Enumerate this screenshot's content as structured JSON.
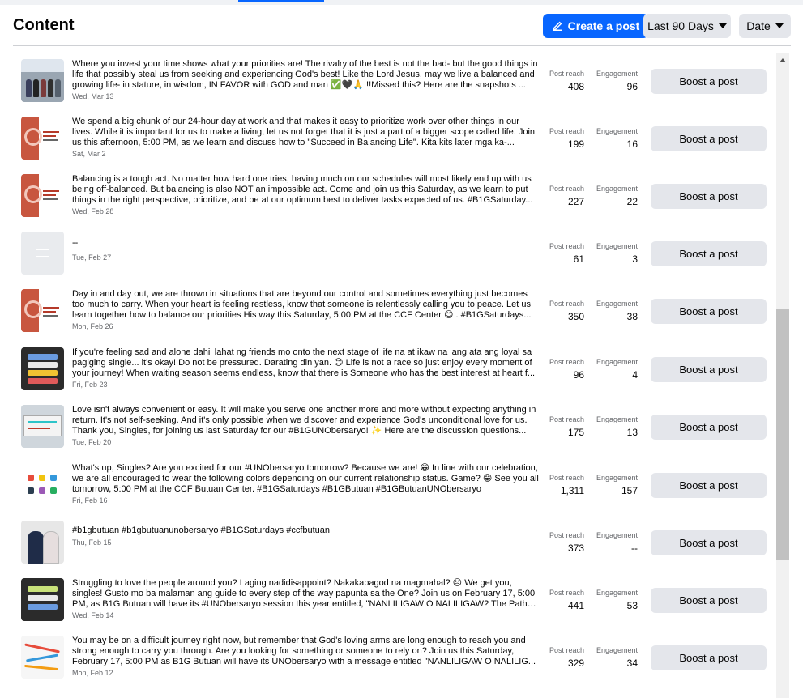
{
  "header": {
    "title": "Content",
    "create_label": "Create a post",
    "range_label": "Last 90 Days",
    "sort_label": "Date"
  },
  "labels": {
    "reach": "Post reach",
    "engagement": "Engagement",
    "boost": "Boost a post"
  },
  "posts": [
    {
      "thumb": "group-photo",
      "caption": "Where you invest your time shows what your priorities are! The rivalry of the best is not the bad- but the good things in life that possibly steal us from seeking and experiencing God's best! Like the Lord Jesus, may we live a balanced and growing life- in stature, in wisdom, IN FAVOR with GOD and man ✅🖤🙏 !!Missed this? Here are the snapshots ...",
      "date": "Wed, Mar 13",
      "reach": "408",
      "engagement": "96"
    },
    {
      "thumb": "event-poster",
      "caption": "We spend a big chunk of our 24-hour day at work and that makes it easy to prioritize work over other things in our lives. While it is important for us to make a living, let us not forget that it is just a part of a bigger scope called life. Join us this afternoon, 5:00 PM, as we learn and discuss how to \"Succeed in Balancing Life\". Kita kits later mga ka-...",
      "date": "Sat, Mar 2",
      "reach": "199",
      "engagement": "16"
    },
    {
      "thumb": "event-poster",
      "caption": "Balancing is a tough act. No matter how hard one tries, having much on our schedules will most likely end up with us being off-balanced. But balancing is also NOT an impossible act. Come and join us this Saturday, as we learn to put things in the right perspective, prioritize, and be at our optimum best to deliver tasks expected of us. #B1GSaturday...",
      "date": "Wed, Feb 28",
      "reach": "227",
      "engagement": "22"
    },
    {
      "thumb": "placeholder",
      "caption": "--",
      "date": "Tue, Feb 27",
      "reach": "61",
      "engagement": "3"
    },
    {
      "thumb": "event-poster",
      "caption": "Day in and day out, we are thrown in situations that are beyond our control and sometimes everything just becomes too much to carry. When your heart is feeling restless, know that someone is relentlessly calling you to peace. Let us learn together how to balance our priorities His way this Saturday, 5:00 PM at the CCF Center 😊 . #B1GSaturdays...",
      "date": "Mon, Feb 26",
      "reach": "350",
      "engagement": "38"
    },
    {
      "thumb": "dark-poster",
      "caption": "If you're feeling sad and alone dahil lahat ng friends mo onto the next stage of life na at ikaw na lang ata ang loyal sa pagiging single... it's okay! Do not be pressured. Darating din yan. 😊 Life is not a race so just enjoy every moment of your journey! When waiting season seems endless, know that there is Someone who has the best interest at heart f...",
      "date": "Fri, Feb 23",
      "reach": "96",
      "engagement": "4"
    },
    {
      "thumb": "whiteboard",
      "caption": "Love isn't always convenient or easy. It will make you serve one another more and more without expecting anything in return. It's not self-seeking. And it's only possible when we discover and experience God's unconditional love for us. Thank you, Singles, for joining us last Saturday for our #B1GUNObersaryo! ✨ Here are the discussion questions...",
      "date": "Tue, Feb 20",
      "reach": "175",
      "engagement": "13"
    },
    {
      "thumb": "shirt-colors",
      "caption": "What's up, Singles? Are you excited for our #UNObersaryo tomorrow? Because we are! 😁 In line with our celebration, we are all encouraged to wear the following colors depending on our current relationship status. Game? 😁 See you all tomorrow, 5:00 PM at the CCF Butuan Center. #B1GSaturdays #B1GButuan #B1GButuanUNObersaryo",
      "date": "Fri, Feb 16",
      "reach": "1,311",
      "engagement": "157"
    },
    {
      "thumb": "couple-photo",
      "caption": "#b1gbutuan #b1gbutuanunobersaryo #B1GSaturdays #ccfbutuan",
      "date": "Thu, Feb 15",
      "reach": "373",
      "engagement": "--"
    },
    {
      "thumb": "dark-poster",
      "caption": "Struggling to love the people around you? Laging nadidisappoint? Nakakapagod na magmahal? 😣 We get you, singles! Gusto mo ba malaman ang guide to every step of the way papunta sa the One? Join us on February 17, 5:00 PM, as B1G Butuan will have its #UNObersaryo session this year entitled, \"NANLILIGAW O NALILIGAW? The Path th...",
      "date": "Wed, Feb 14",
      "reach": "441",
      "engagement": "53"
    },
    {
      "thumb": "route-map",
      "caption": "You may be on a difficult journey right now, but remember that God's loving arms are long enough to reach you and strong enough to carry you through. Are you looking for something or someone to rely on? Join us this Saturday, February 17, 5:00 PM as B1G Butuan will have its UNObersaryo with a message entitled \"NANLILIGAW O NALILIG...",
      "date": "Mon, Feb 12",
      "reach": "329",
      "engagement": "34"
    }
  ],
  "colors": {
    "accent": "#0866ff",
    "button_bg": "#e4e6eb",
    "muted_text": "#65676b"
  }
}
